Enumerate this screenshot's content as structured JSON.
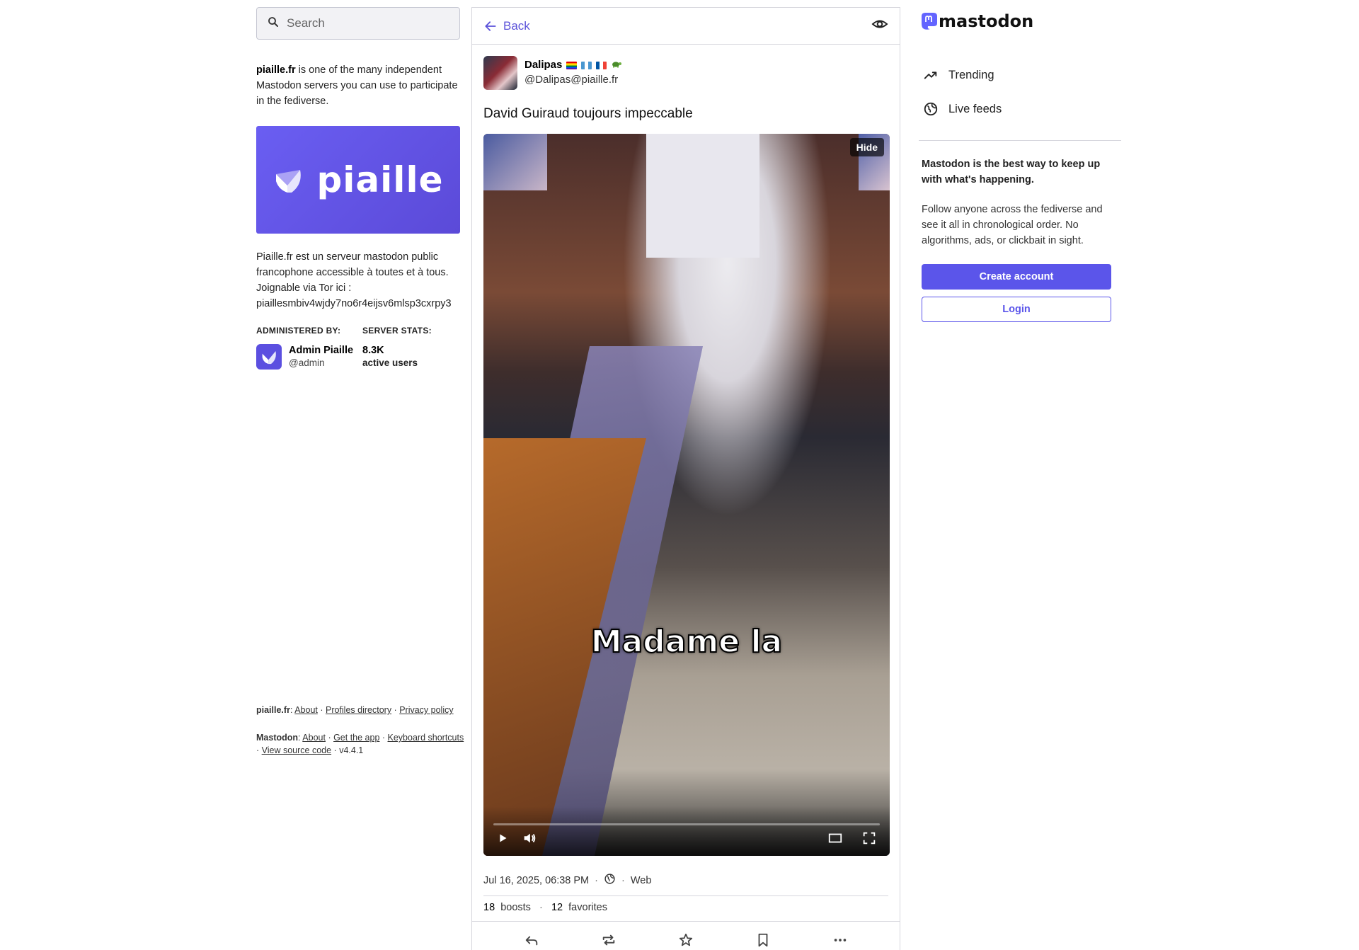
{
  "search": {
    "placeholder": "Search"
  },
  "intro": {
    "server": "piaille.fr",
    "text": " is one of the many independent Mastodon servers you can use to participate in the fediverse."
  },
  "banner": {
    "brand": "piaille"
  },
  "description": {
    "lines": [
      "Piaille.fr est un serveur mastodon public",
      "francophone accessible à toutes et à tous.",
      "Joignable via Tor ici :",
      "piaillesmbiv4wjdy7no6r4eijsv6mlsp3cxrpy3"
    ]
  },
  "administered": {
    "heading": "ADMINISTERED BY:",
    "name": "Admin Piaille",
    "handle": "@admin"
  },
  "stats": {
    "heading": "SERVER STATS:",
    "value": "8.3K",
    "label": "active users"
  },
  "footer": {
    "server_label": "piaille.fr",
    "server_links": [
      "About",
      "Profiles directory",
      "Privacy policy"
    ],
    "mastodon_label": "Mastodon",
    "mastodon_links": [
      "About",
      "Get the app",
      "Keyboard shortcuts",
      "View source code"
    ],
    "version": "v4.4.1"
  },
  "topbar": {
    "back_label": "Back"
  },
  "post": {
    "display_name": "Dalipas",
    "handle": "@Dalipas@piaille.fr",
    "text": "David Guiraud toujours impeccable",
    "video_caption": "Madame la",
    "hide_label": "Hide",
    "timestamp": "Jul 16, 2025, 06:38 PM",
    "app": "Web",
    "boosts_count": "18",
    "boosts_label": "boosts",
    "favorites_count": "12",
    "favorites_label": "favorites"
  },
  "right": {
    "wordmark": "mastodon",
    "nav": [
      "Trending",
      "Live feeds"
    ],
    "pitch_title": "Mastodon is the best way to keep up with what's happening.",
    "pitch_body": "Follow anyone across the fediverse and see it all in chronological order. No algorithms, ads, or clickbait in sight.",
    "create_account": "Create account",
    "login": "Login"
  },
  "colors": {
    "accent": "#5b55ea",
    "banner": "#6a5ef2"
  }
}
